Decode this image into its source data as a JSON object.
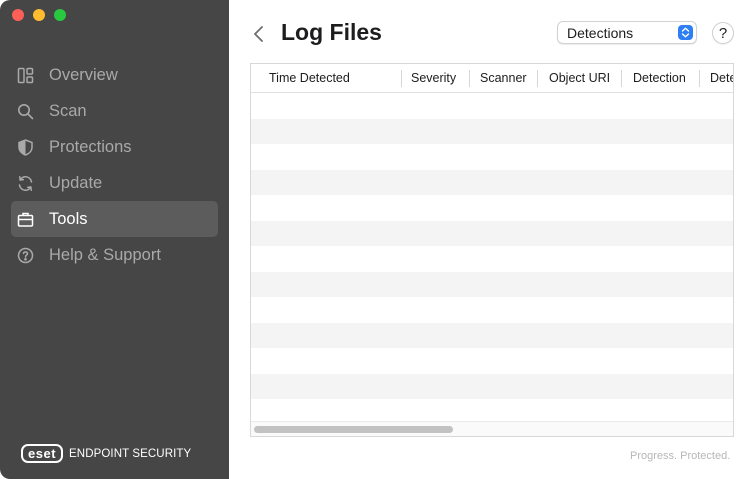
{
  "window": {
    "traffic_lights": {
      "close": "#fe5f57",
      "minimize": "#febc2e",
      "maximize": "#28c840"
    }
  },
  "sidebar": {
    "items": [
      {
        "label": "Overview",
        "icon": "overview-icon",
        "active": false
      },
      {
        "label": "Scan",
        "icon": "search-icon",
        "active": false
      },
      {
        "label": "Protections",
        "icon": "shield-icon",
        "active": false
      },
      {
        "label": "Update",
        "icon": "refresh-icon",
        "active": false
      },
      {
        "label": "Tools",
        "icon": "briefcase-icon",
        "active": true
      },
      {
        "label": "Help & Support",
        "icon": "question-circle-icon",
        "active": false
      }
    ],
    "brand": {
      "logo": "eset",
      "name": "ENDPOINT SECURITY"
    }
  },
  "main": {
    "title": "Log Files",
    "log_type_select": {
      "value": "Detections"
    },
    "help_label": "?",
    "table": {
      "columns": [
        "Time Detected",
        "Severity",
        "Scanner",
        "Object URI",
        "Detection",
        "Dete"
      ],
      "rows": []
    },
    "tagline": "Progress. Protected."
  },
  "colors": {
    "sidebar_bg": "#464646",
    "active_item_bg": "#5c5c5c",
    "accent": "#2f7ff4"
  }
}
